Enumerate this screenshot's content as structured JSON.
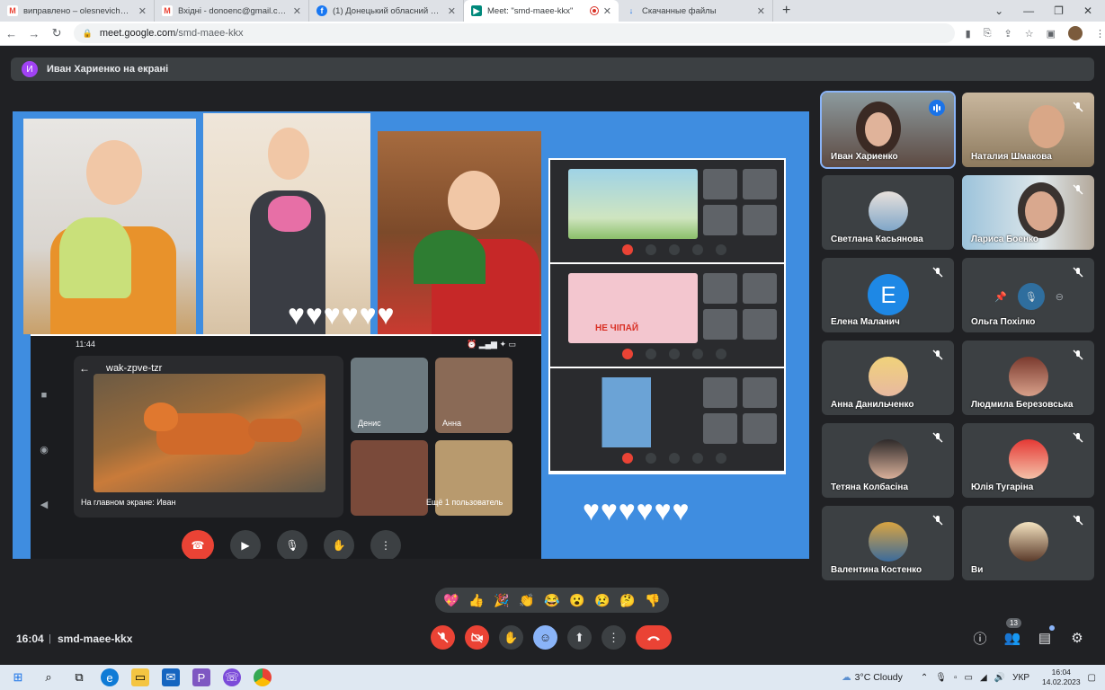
{
  "browser": {
    "tabs": [
      {
        "title": "виправлено – olesnevich88a@gm",
        "icon": "gmail-icon",
        "color": "#ea4335",
        "letter": "M",
        "active": false
      },
      {
        "title": "Вхідні - donoenc@gmail.com - G",
        "icon": "gmail-icon",
        "color": "#ea4335",
        "letter": "M",
        "active": false
      },
      {
        "title": "(1) Донецький обласний еколог",
        "icon": "facebook-icon",
        "color": "#1877f2",
        "letter": "f",
        "active": false
      },
      {
        "title": "Meet: \"smd-maee-kkx\"",
        "icon": "meet-icon",
        "color": "#00897b",
        "letter": "▶",
        "active": true
      },
      {
        "title": "Скачанные файлы",
        "icon": "download-icon",
        "color": "#1a73e8",
        "letter": "↓",
        "active": false
      }
    ],
    "url_host": "meet.google.com",
    "url_path": "/smd-maee-kkx"
  },
  "meet": {
    "presenting_initial": "И",
    "presenting_text": "Иван Хариенко на екрані",
    "phone": {
      "time": "11:44",
      "meeting_code": "wak-zpve-tzr",
      "main_label": "На главном экране: Иван",
      "tile_denis": "Денис",
      "tile_anna": "Анна",
      "more_users": "Ещё 1 пользователь"
    },
    "screen_caption": "НЕ ЧІПАЙ",
    "participants": [
      {
        "name": "Иван Хариенко",
        "kind": "video",
        "speaking": true,
        "active": true
      },
      {
        "name": "Наталия Шмакова",
        "kind": "video",
        "muted": true
      },
      {
        "name": "Светлана Касьянова",
        "kind": "avatar"
      },
      {
        "name": "Лариса Боенко",
        "kind": "video",
        "muted": true
      },
      {
        "name": "Елена Маланич",
        "kind": "letter",
        "letter": "Е",
        "muted": true
      },
      {
        "name": "Ольга Похілко",
        "kind": "hover",
        "muted": true
      },
      {
        "name": "Анна Данильченко",
        "kind": "avatar",
        "muted": true
      },
      {
        "name": "Людмила Березовська",
        "kind": "avatar",
        "muted": true
      },
      {
        "name": "Тетяна Колбасіна",
        "kind": "avatar",
        "muted": true
      },
      {
        "name": "Юлія Тугаріна",
        "kind": "avatar",
        "muted": true
      },
      {
        "name": "Валентина Костенко",
        "kind": "avatar",
        "muted": true
      },
      {
        "name": "Ви",
        "kind": "avatar",
        "muted": true
      }
    ],
    "reactions": [
      "💖",
      "👍",
      "🎉",
      "👏",
      "😂",
      "😮",
      "😢",
      "🤔",
      "👎"
    ],
    "clock": "16:04",
    "separator": "|",
    "meeting_code": "smd-maee-kkx",
    "people_count": "13"
  },
  "taskbar": {
    "weather": "3°C  Cloudy",
    "lang": "УКР",
    "time": "16:04",
    "date": "14.02.2023"
  }
}
